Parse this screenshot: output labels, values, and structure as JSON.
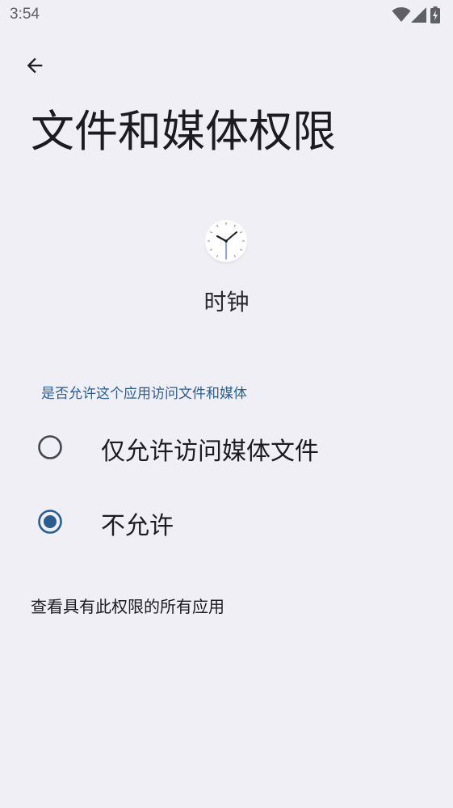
{
  "status_bar": {
    "time": "3:54",
    "icons": [
      "wifi-icon",
      "cellular-signal-icon",
      "battery-charging-icon"
    ]
  },
  "header": {
    "back_icon": "arrow-back-icon",
    "title": "文件和媒体权限"
  },
  "app": {
    "icon": "clock-icon",
    "name": "时钟"
  },
  "permission": {
    "section_label": "是否允许这个应用访问文件和媒体",
    "options": [
      {
        "label": "仅允许访问媒体文件",
        "selected": false
      },
      {
        "label": "不允许",
        "selected": true
      }
    ],
    "view_all_link": "查看具有此权限的所有应用"
  },
  "colors": {
    "background": "#f0eff5",
    "accent": "#2b5d8f",
    "text": "#1c1b1f"
  }
}
